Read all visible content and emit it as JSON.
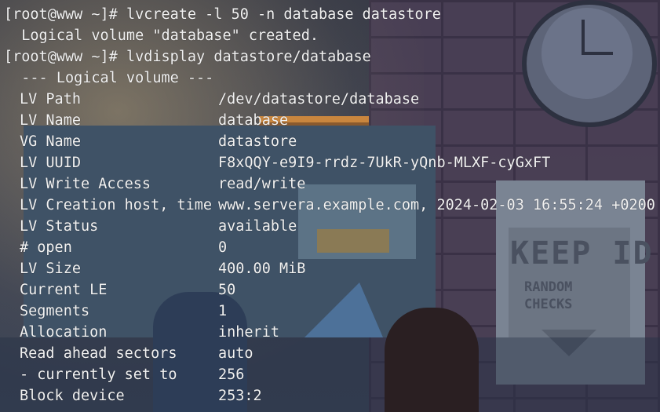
{
  "terminal": {
    "lines": [
      {
        "prompt": "[root@www ~]# ",
        "command": "lvcreate -l 50 -n database datastore"
      },
      {
        "output": "  Logical volume \"database\" created."
      },
      {
        "prompt": "[root@www ~]# ",
        "command": "lvdisplay datastore/database"
      },
      {
        "output": "  --- Logical volume ---"
      }
    ],
    "fields": [
      {
        "key": "LV Path",
        "value": "/dev/datastore/database"
      },
      {
        "key": "LV Name",
        "value": "database"
      },
      {
        "key": "VG Name",
        "value": "datastore"
      },
      {
        "key": "LV UUID",
        "value": "F8xQQY-e9I9-rrdz-7UkR-yQnb-MLXF-cyGxFT"
      },
      {
        "key": "LV Write Access",
        "value": "read/write"
      },
      {
        "key": "LV Creation host, time",
        "value": "www.servera.example.com, 2024-02-03 16:55:24 +0200"
      },
      {
        "key": "LV Status",
        "value": "available"
      },
      {
        "key": "# open",
        "value": "0"
      },
      {
        "key": "LV Size",
        "value": "400.00 MiB"
      },
      {
        "key": "Current LE",
        "value": "50"
      },
      {
        "key": "Segments",
        "value": "1"
      },
      {
        "key": "Allocation",
        "value": "inherit"
      },
      {
        "key": "Read ahead sectors",
        "value": "auto"
      },
      {
        "key": "- currently set to",
        "value": "256"
      },
      {
        "key": "Block device",
        "value": "253:2"
      }
    ]
  },
  "wallpaper": {
    "sign_title": "KEEP ID",
    "sign_subtitle_1": "RANDOM",
    "sign_subtitle_2": "CHECKS"
  },
  "colors": {
    "text": "#f2f2f2",
    "background": "#2b2f3a"
  }
}
